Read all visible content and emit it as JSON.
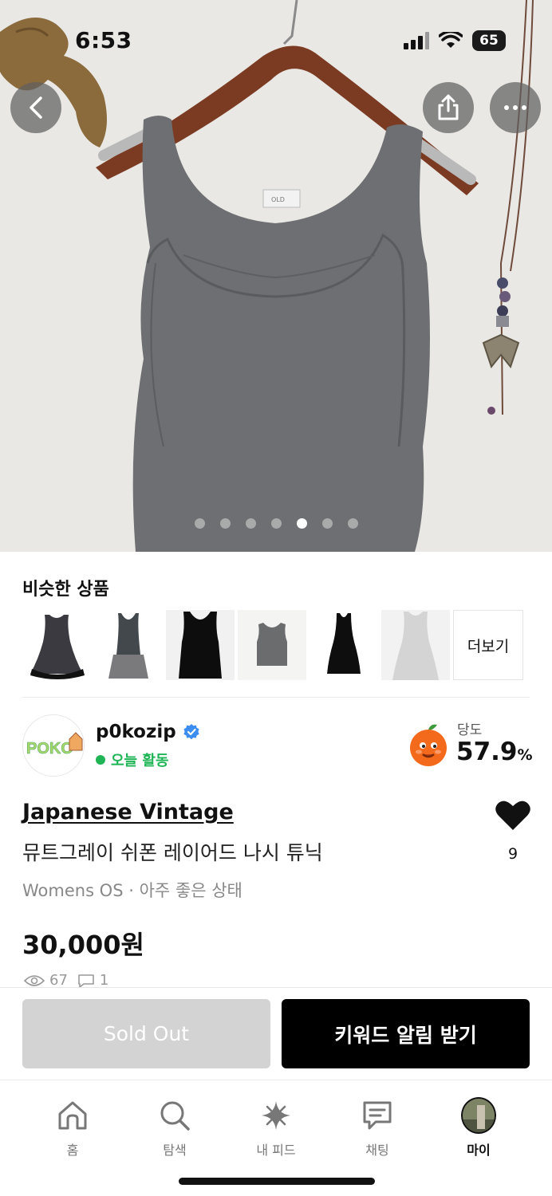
{
  "status_bar": {
    "time": "6:53",
    "battery": "65"
  },
  "similar": {
    "title": "비슷한 상품",
    "more_label": "더보기",
    "items": [
      {
        "icon": "black-dress-thumb"
      },
      {
        "icon": "gray-layered-tank-thumb"
      },
      {
        "icon": "black-tank-thumb"
      },
      {
        "icon": "gray-tank-thumb"
      },
      {
        "icon": "black-tiered-dress-thumb"
      },
      {
        "icon": "light-gray-dress-thumb"
      }
    ]
  },
  "seller": {
    "name": "p0kozip",
    "activity": "오늘 활동",
    "avatar_text": "POKO",
    "sweetness_label": "당도",
    "sweetness_value": "57.9",
    "sweetness_unit": "%"
  },
  "product": {
    "brand": "Japanese Vintage",
    "name": "뮤트그레이 쉬폰 레이어드 나시 튜닉",
    "meta": "Womens OS · 아주 좋은 상태",
    "price": "30,000원",
    "views": "67",
    "comments": "1",
    "likes": "9",
    "carousel_total": 7,
    "carousel_active": 5
  },
  "actions": {
    "sold_out": "Sold Out",
    "keyword_alert": "키워드 알림 받기"
  },
  "tabs": [
    {
      "label": "홈",
      "icon": "home-icon"
    },
    {
      "label": "탐색",
      "icon": "search-icon"
    },
    {
      "label": "내 피드",
      "icon": "sparkle-icon"
    },
    {
      "label": "채팅",
      "icon": "chat-icon"
    },
    {
      "label": "마이",
      "icon": "avatar"
    }
  ],
  "colors": {
    "accent_green": "#1fb556",
    "verified_blue": "#3b8ef0",
    "primary_black": "#000000",
    "disabled_gray": "#d3d3d3"
  }
}
